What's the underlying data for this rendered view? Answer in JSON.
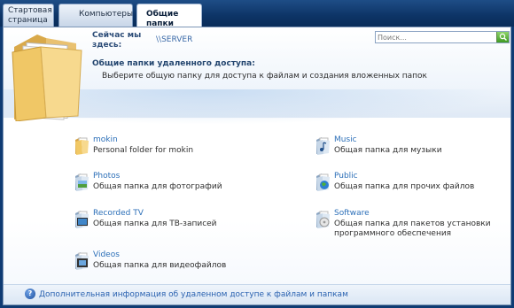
{
  "tabs": [
    {
      "label_line1": "Стартовая",
      "label_line2": "страница",
      "active": false
    },
    {
      "label": "Компьютеры",
      "active": false
    },
    {
      "label": "Общие папки",
      "active": true
    }
  ],
  "location": {
    "label": "Сейчас мы здесь:",
    "value": "\\\\SERVER"
  },
  "search": {
    "placeholder": "Поиск...",
    "value": ""
  },
  "section": {
    "title": "Общие папки удаленного доступа:",
    "description": "Выберите общую папку для доступа к файлам и создания вложенных папок"
  },
  "folders": [
    {
      "name": "mokin",
      "description": "Personal folder for mokin",
      "icon": "folder-icon"
    },
    {
      "name": "Music",
      "description": "Общая папка для музыки",
      "icon": "music-folder-icon"
    },
    {
      "name": "Photos",
      "description": "Общая папка для фотографий",
      "icon": "photos-folder-icon"
    },
    {
      "name": "Public",
      "description": "Общая папка для прочих файлов",
      "icon": "public-folder-icon"
    },
    {
      "name": "Recorded TV",
      "description": "Общая папка для ТВ-записей",
      "icon": "tv-folder-icon"
    },
    {
      "name": "Software",
      "description": "Общая папка для пакетов установки программного обеспечения",
      "description_line1": "Общая папка для пакетов установки",
      "description_line2": "программного обеспечения",
      "icon": "software-folder-icon"
    },
    {
      "name": "Videos",
      "description": "Общая папка для видеофайлов",
      "icon": "videos-folder-icon"
    }
  ],
  "footer": {
    "help_text": "Дополнительная информация об удаленном доступе к файлам и папкам"
  },
  "colors": {
    "titlebar": "#0f3b73",
    "link": "#2c6fb8",
    "accent": "#24466f"
  }
}
